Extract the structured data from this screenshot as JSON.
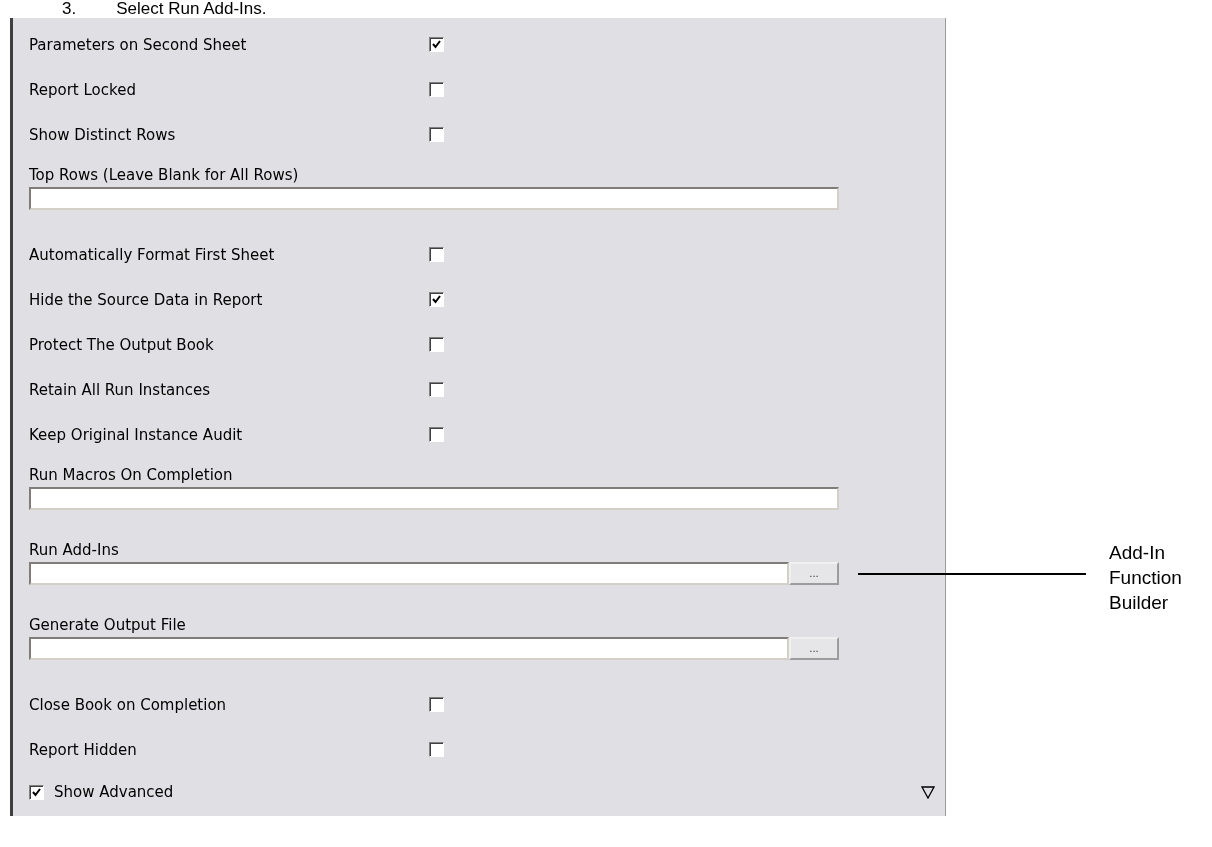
{
  "instruction": {
    "number": "3.",
    "text": "Select Run Add-Ins."
  },
  "options": [
    {
      "kind": "checkbox",
      "label": "Parameters on Second Sheet",
      "checked": true
    },
    {
      "kind": "checkbox",
      "label": "Report Locked",
      "checked": false
    },
    {
      "kind": "checkbox",
      "label": "Show Distinct Rows",
      "checked": false
    },
    {
      "kind": "text",
      "label": "Top Rows (Leave Blank for All Rows)"
    },
    {
      "kind": "checkbox",
      "label": "Automatically Format First Sheet",
      "checked": false
    },
    {
      "kind": "checkbox",
      "label": "Hide the Source Data in Report",
      "checked": true
    },
    {
      "kind": "checkbox",
      "label": "Protect The Output Book",
      "checked": false
    },
    {
      "kind": "checkbox",
      "label": "Retain All Run Instances",
      "checked": false
    },
    {
      "kind": "checkbox",
      "label": "Keep Original Instance Audit",
      "checked": false
    },
    {
      "kind": "text",
      "label": "Run Macros On Completion"
    },
    {
      "kind": "browse",
      "label": "Run Add-Ins",
      "button": "..."
    },
    {
      "kind": "browse",
      "label": "Generate Output File",
      "button": "..."
    },
    {
      "kind": "checkbox",
      "label": "Close Book on Completion",
      "checked": false
    },
    {
      "kind": "checkbox",
      "label": "Report Hidden",
      "checked": false
    }
  ],
  "show_advanced": {
    "label": "Show Advanced",
    "checked": true
  },
  "callout": {
    "text": "Add-In Function Builder"
  }
}
